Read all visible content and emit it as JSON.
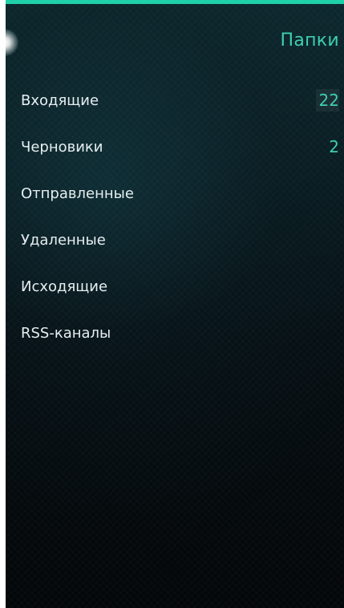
{
  "header": {
    "title": "Папки"
  },
  "colors": {
    "accent": "#1fd0a8",
    "title_color": "#3ecfb1",
    "background": "#0a1f24"
  },
  "folders": [
    {
      "label": "Входящие",
      "count": "22"
    },
    {
      "label": "Черновики",
      "count": "2"
    },
    {
      "label": "Отправленные",
      "count": ""
    },
    {
      "label": "Удаленные",
      "count": ""
    },
    {
      "label": "Исходящие",
      "count": ""
    },
    {
      "label": "RSS-каналы",
      "count": ""
    }
  ]
}
